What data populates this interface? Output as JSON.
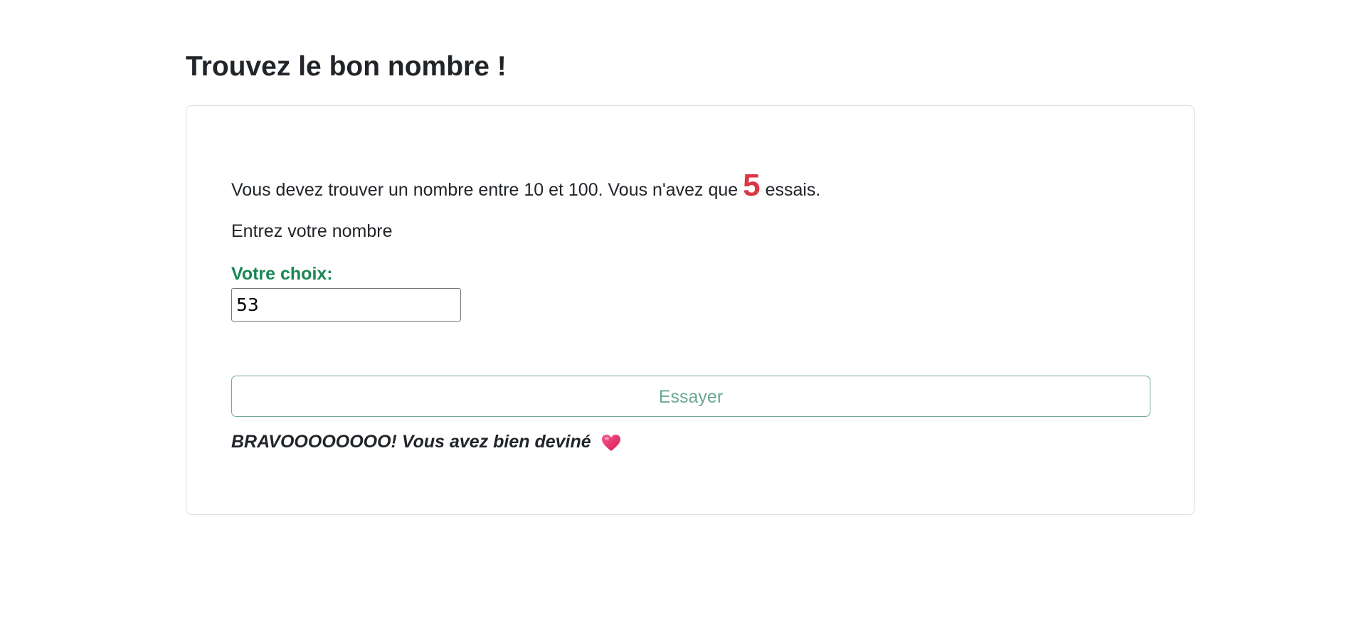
{
  "page": {
    "title": "Trouvez le bon nombre !"
  },
  "game": {
    "instructions_before": "Vous devez trouver un nombre entre 10 et 100. Vous n'avez que ",
    "tries": "5",
    "instructions_after": " essais.",
    "prompt": "Entrez votre nombre",
    "choice_label": "Votre choix:",
    "choice_value": "53",
    "try_button_label": "Essayer",
    "result_message": "BRAVOOOOOOOO! Vous avez bien deviné",
    "result_icon": "heart-icon"
  },
  "colors": {
    "text": "#212529",
    "tries_accent": "#dc3545",
    "label_green": "#198754",
    "button_border": "#74a79a",
    "button_text": "#6aa88f",
    "heart": "#e8336d"
  }
}
